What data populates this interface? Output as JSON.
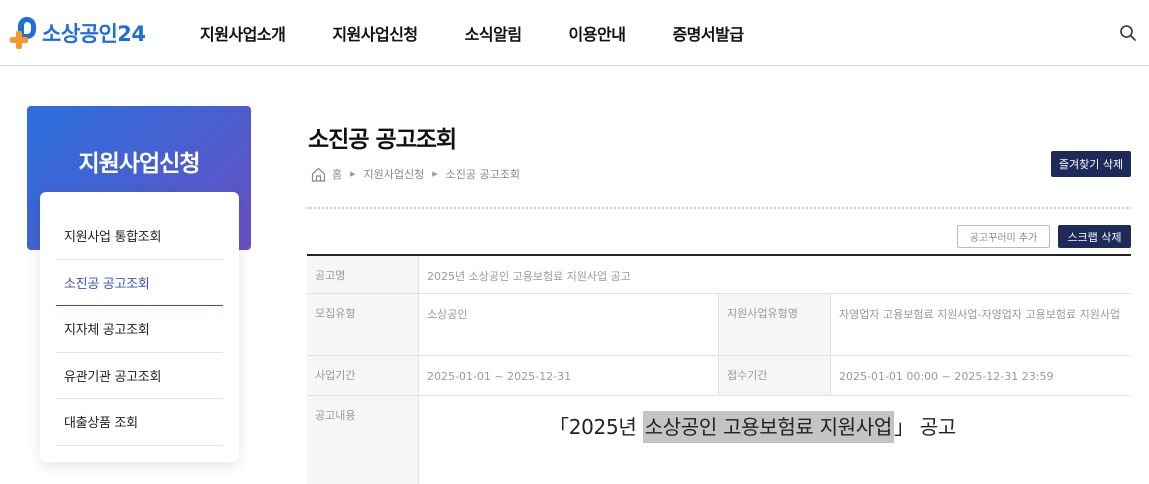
{
  "logo": {
    "text": "소상공인24"
  },
  "nav": {
    "items": [
      "지원사업소개",
      "지원사업신청",
      "소식알림",
      "이용안내",
      "증명서발급"
    ]
  },
  "sidebar": {
    "title": "지원사업신청",
    "items": [
      {
        "label": "지원사업 통합조회",
        "active": false
      },
      {
        "label": "소진공 공고조회",
        "active": true
      },
      {
        "label": "지자체 공고조회",
        "active": false
      },
      {
        "label": "유관기관 공고조회",
        "active": false
      },
      {
        "label": "대출상품 조회",
        "active": false
      }
    ]
  },
  "main": {
    "title": "소진공 공고조회",
    "breadcrumb": [
      "홈",
      "지원사업신청",
      "소진공 공고조회"
    ],
    "buttons": {
      "favorite_delete": "즐겨찾기 삭제",
      "add_bundle": "공고꾸러미 추가",
      "scrap_delete": "스크랩 삭제"
    },
    "table": {
      "notice_name_label": "공고명",
      "notice_name": "2025년 소상공인 고용보험료 지원사업 공고",
      "recruit_type_label": "모집유형",
      "recruit_type": "소상공인",
      "support_name_label": "지원사업유형명",
      "support_name": "자영업자 고용보험료 지원사업-자영업자 고용보험료 지원사업",
      "period_label": "사업기간",
      "period": "2025-01-01 ~ 2025-12-31",
      "apply_label": "접수기간",
      "apply_period": "2025-01-01 00:00 ~ 2025-12-31 23:59",
      "content_label": "공고내용",
      "content_prefix": "「2025년 ",
      "content_highlight": "소상공인 고용보험료 지원사업",
      "content_suffix": "」 공고"
    }
  },
  "colors": {
    "brand_blue": "#1e6fd9",
    "brand_orange": "#f39a2c",
    "accent_navy": "#1d2a5a",
    "active_menu": "#3f4fc0"
  }
}
